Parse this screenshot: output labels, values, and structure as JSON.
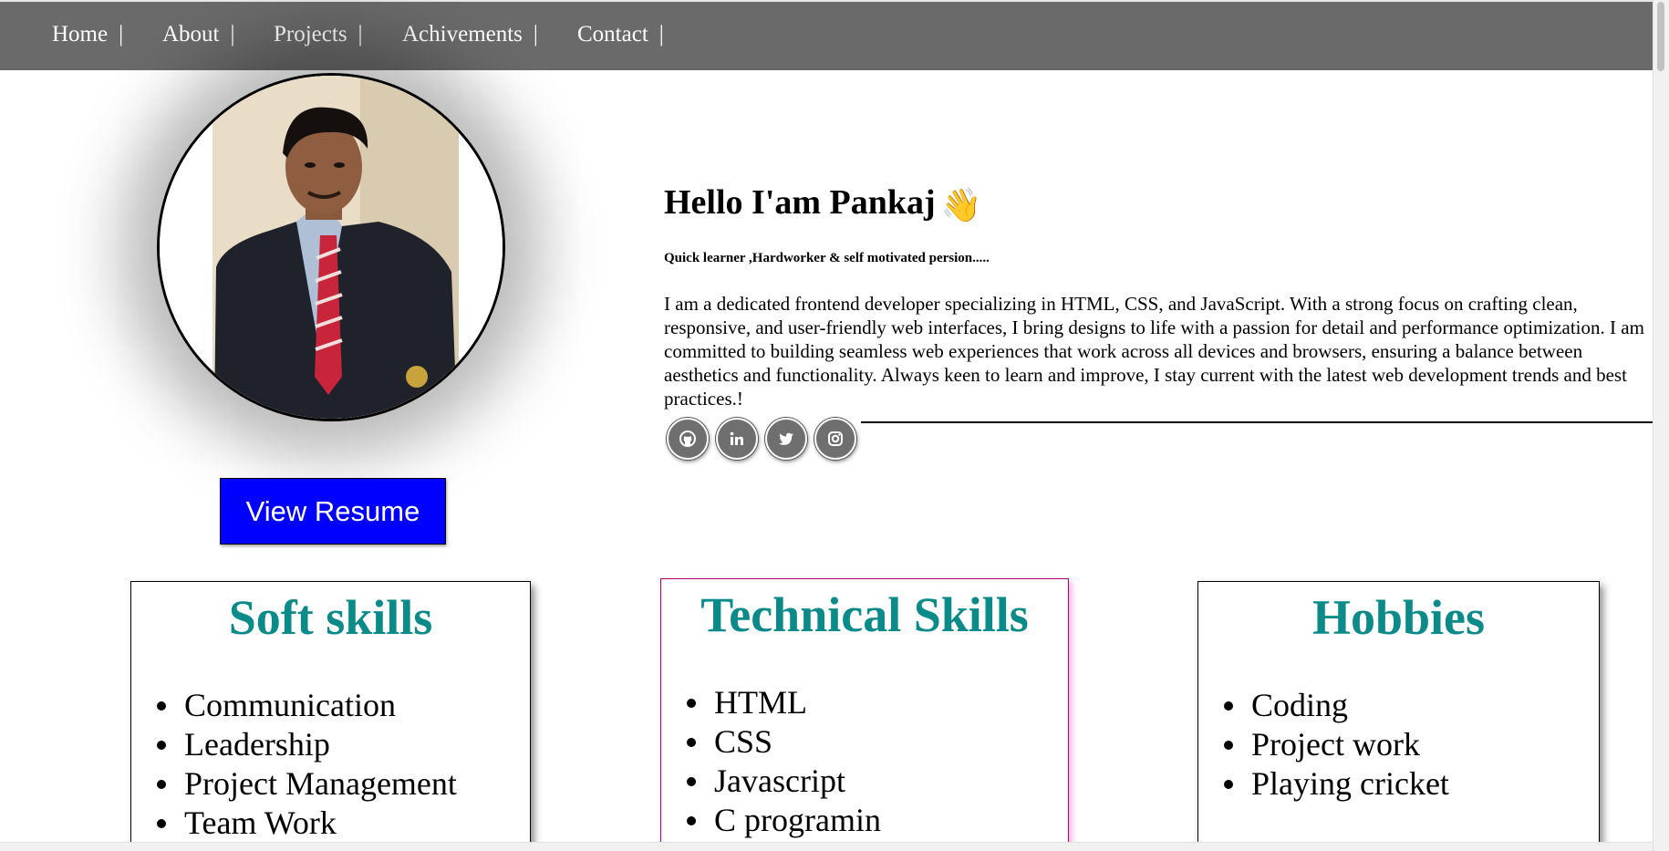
{
  "nav": {
    "items": [
      {
        "label": "Home",
        "sep": "|"
      },
      {
        "label": "About",
        "sep": "|"
      },
      {
        "label": "Projects",
        "sep": "|"
      },
      {
        "label": "Achivements",
        "sep": "|"
      },
      {
        "label": "Contact",
        "sep": "|"
      }
    ]
  },
  "profile": {
    "resume_label": "View Resume"
  },
  "intro": {
    "heading": "Hello I'am Pankaj",
    "wave": "👋",
    "tagline": "Quick learner ,Hardworker & self motivated persion.....",
    "about": "I am a dedicated frontend developer specializing in HTML, CSS, and JavaScript. With a strong focus on crafting clean, responsive, and user-friendly web interfaces, I bring designs to life with a passion for detail and performance optimization. I am committed to building seamless web experiences that work across all devices and browsers, ensuring a balance between aesthetics and functionality. Always keen to learn and improve, I stay current with the latest web development trends and best practices.!"
  },
  "socials": [
    {
      "icon": "github-icon"
    },
    {
      "icon": "linkedin-icon"
    },
    {
      "icon": "twitter-icon"
    },
    {
      "icon": "instagram-icon"
    }
  ],
  "cards": {
    "soft": {
      "title": "Soft skills",
      "items": [
        "Communication",
        "Leadership",
        "Project Management",
        "Team Work"
      ]
    },
    "technical": {
      "title": "Technical Skills",
      "items": [
        "HTML",
        "CSS",
        "Javascript",
        "C programin"
      ]
    },
    "hobbies": {
      "title": "Hobbies",
      "items": [
        "Coding",
        "Project work",
        "Playing cricket"
      ]
    }
  },
  "colors": {
    "navbar": "#6a6a6a",
    "resume_button": "#0000ff",
    "card_title": "#0a8a88"
  }
}
